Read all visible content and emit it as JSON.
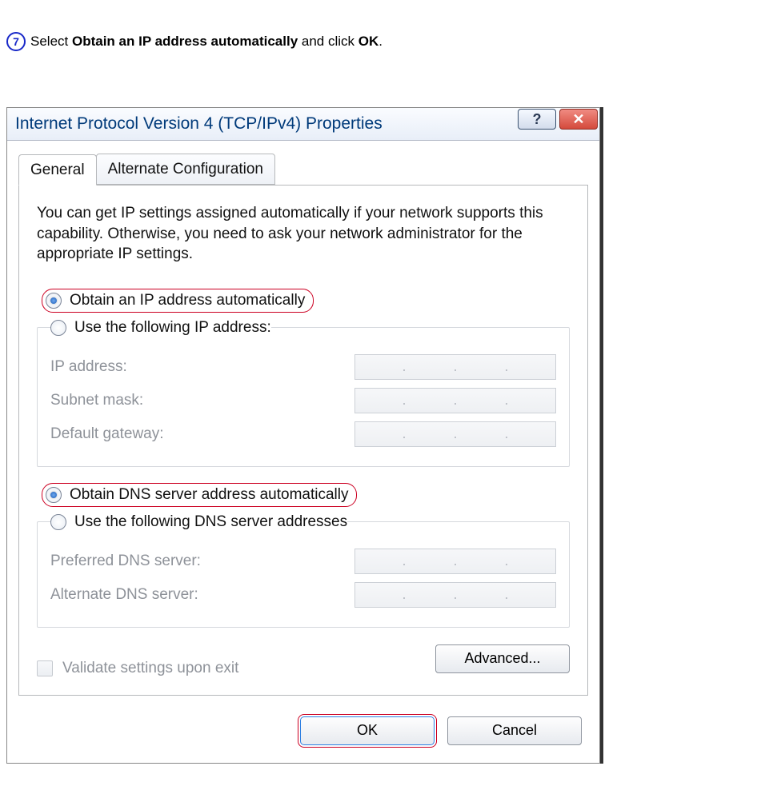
{
  "instruction": {
    "step_number": "7",
    "prefix": "Select ",
    "bold1": "Obtain an IP address automatically",
    "middle": " and click ",
    "bold2": "OK",
    "suffix": "."
  },
  "dialog": {
    "title": "Internet Protocol Version 4 (TCP/IPv4) Properties",
    "help_glyph": "?",
    "close_glyph": "✕",
    "tabs": {
      "general": "General",
      "alt": "Alternate Configuration"
    },
    "intro": "You can get IP settings assigned automatically if your network supports this capability. Otherwise, you need to ask your network administrator for the appropriate IP settings.",
    "ip": {
      "auto": "Obtain an IP address automatically",
      "manual": "Use the following IP address:",
      "fields": {
        "ip": "IP address:",
        "mask": "Subnet mask:",
        "gw": "Default gateway:"
      }
    },
    "dns": {
      "auto": "Obtain DNS server address automatically",
      "manual": "Use the following DNS server addresses",
      "fields": {
        "pref": "Preferred DNS server:",
        "alt": "Alternate DNS server:"
      }
    },
    "validate": "Validate settings upon exit",
    "advanced": "Advanced...",
    "ok": "OK",
    "cancel": "Cancel"
  }
}
